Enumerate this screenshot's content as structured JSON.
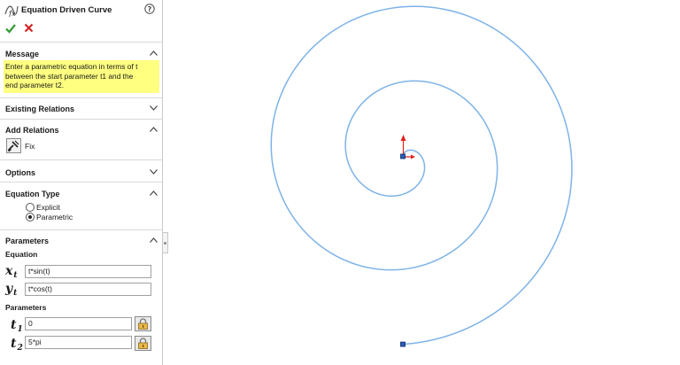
{
  "panel": {
    "title": "Equation Driven Curve",
    "help_icon": "help-icon",
    "ok_icon": "checkmark-icon",
    "cancel_icon": "close-icon",
    "message": {
      "heading": "Message",
      "text_lines": [
        "Enter a parametric equation in terms of t",
        "between the start parameter t1 and the",
        "end parameter t2."
      ]
    },
    "existing_relations": {
      "heading": "Existing Relations"
    },
    "add_relations": {
      "heading": "Add Relations",
      "fix_label": "Fix",
      "fix_icon": "fix-relation-icon"
    },
    "options": {
      "heading": "Options"
    },
    "equation_type": {
      "heading": "Equation Type",
      "options": [
        "Explicit",
        "Parametric"
      ],
      "selected": "Parametric"
    },
    "parameters": {
      "heading": "Parameters",
      "equation_label": "Equation",
      "x_var": "x",
      "x_sub": "t",
      "x_equation": "t*sin(t)",
      "y_var": "y",
      "y_sub": "t",
      "y_equation": "t*cos(t)",
      "params_label": "Parameters",
      "t1_var": "t",
      "t1_sub": "1",
      "t1_value": "0",
      "t2_var": "t",
      "t2_sub": "2",
      "t2_value": "5*pi",
      "lock_icon": "lock-icon"
    }
  },
  "colors": {
    "curve": "#7db3e8",
    "message_bg": "#ffff80",
    "ok": "#2e9b2e",
    "cancel": "#d42020",
    "axis_y": "#e02020",
    "origin": "#2a5db0"
  }
}
